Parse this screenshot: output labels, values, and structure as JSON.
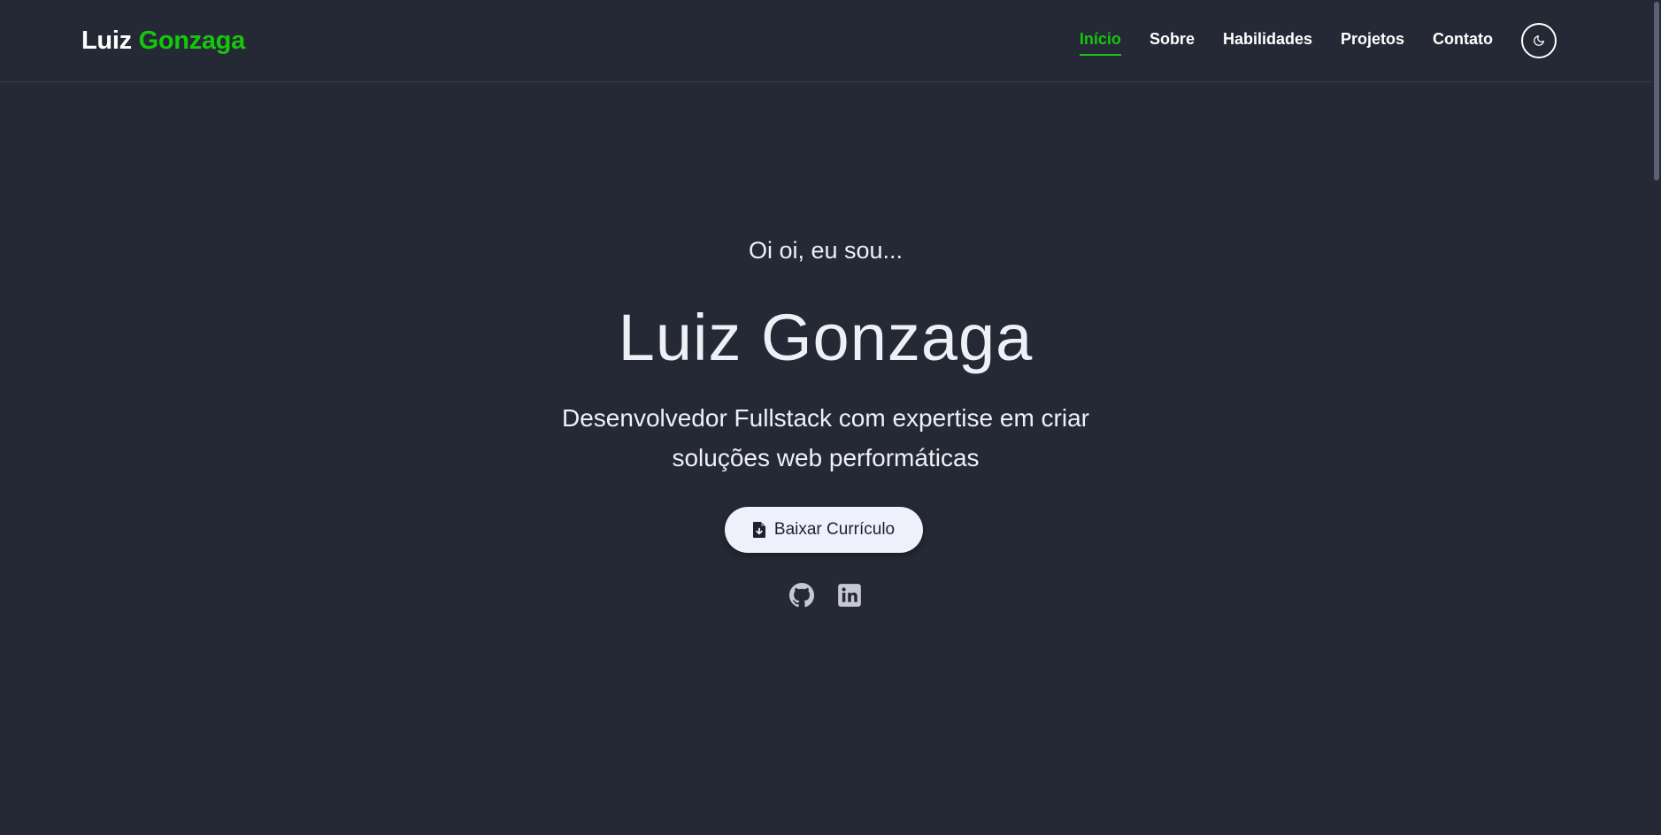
{
  "header": {
    "logo_first": "Luiz",
    "logo_last": "Gonzaga",
    "nav": [
      {
        "label": "Início",
        "active": true
      },
      {
        "label": "Sobre"
      },
      {
        "label": "Habilidades"
      },
      {
        "label": "Projetos"
      },
      {
        "label": "Contato"
      }
    ],
    "theme_toggle_icon": "moon-icon"
  },
  "hero": {
    "greeting": "Oi oi, eu sou...",
    "name": "Luiz Gonzaga",
    "subtitle": "Desenvolvedor Fullstack com expertise em criar soluções web performáticas",
    "cv_button": {
      "label": "Baixar Currículo",
      "icon": "file-download-icon"
    },
    "socials": [
      {
        "icon": "github-icon"
      },
      {
        "icon": "linkedin-icon"
      }
    ]
  },
  "colors": {
    "background": "#252935",
    "accent": "#16c60c",
    "text": "#eef0f8",
    "button_bg": "#eef0fb"
  }
}
